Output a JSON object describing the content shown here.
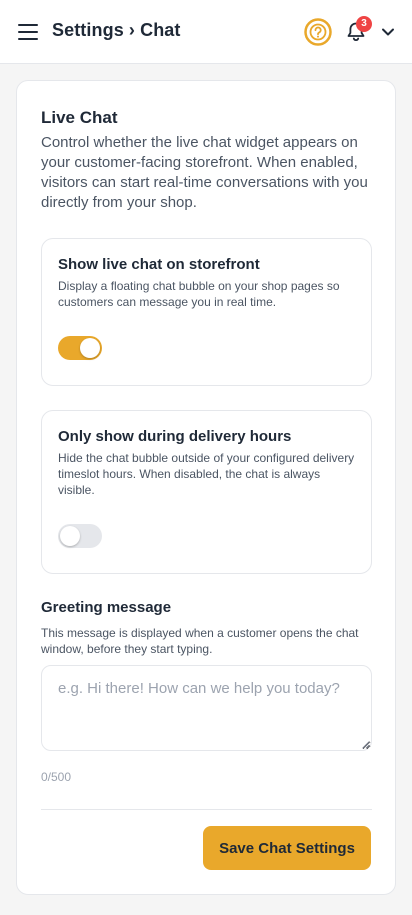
{
  "header": {
    "breadcrumb": "Settings › Chat",
    "notifications_count": "3",
    "icons": [
      "menu-icon",
      "help-icon",
      "bell-icon",
      "chevron-down-icon"
    ]
  },
  "card": {
    "title": "Live Chat",
    "description": "Control whether the live chat widget appears on your customer-facing storefront. When enabled, visitors can start real-time conversations with you directly from your shop."
  },
  "options": [
    {
      "title": "Show live chat on storefront",
      "description": "Display a floating chat bubble on your shop pages so customers can message you in real time.",
      "enabled": true
    },
    {
      "title": "Only show during delivery hours",
      "description": "Hide the chat bubble outside of your configured delivery timeslot hours. When disabled, the chat is always visible.",
      "enabled": false
    }
  ],
  "greeting": {
    "label": "Greeting message",
    "help": "This message is displayed when a customer opens the chat window, before they start typing.",
    "value": "",
    "placeholder": "e.g. Hi there! How can we help you today?",
    "counter": "0/500"
  },
  "save_label": "Save Chat Settings",
  "colors": {
    "accent": "#e9a82b",
    "badge": "#ef4444",
    "toggle_off": "#e5e7eb"
  }
}
